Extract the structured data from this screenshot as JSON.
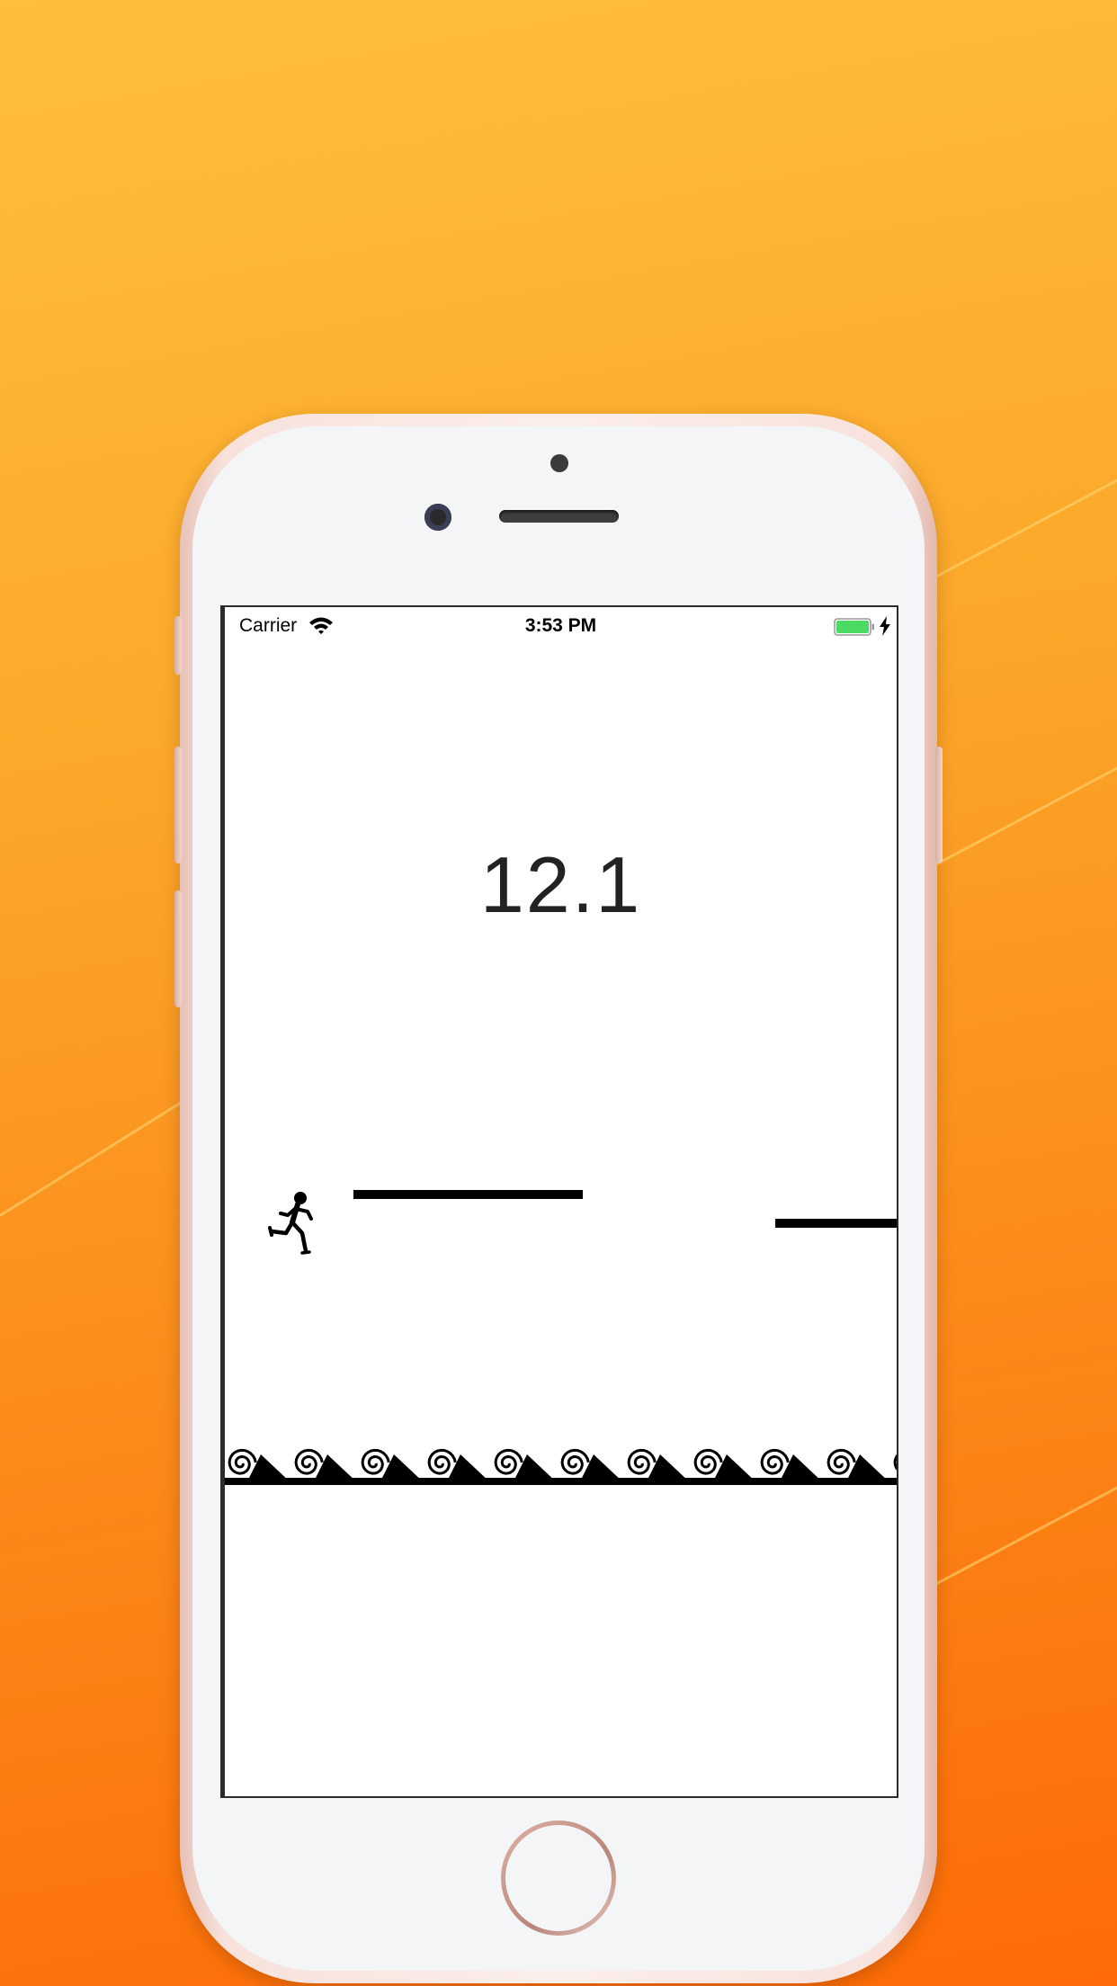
{
  "status_bar": {
    "carrier": "Carrier",
    "time": "3:53 PM",
    "battery_color": "#4cd964"
  },
  "game": {
    "score": "12.1"
  },
  "icons": [
    "wifi-icon",
    "battery-icon",
    "charging-bolt-icon",
    "runner-icon",
    "spiral-waves-icon",
    "camera-icon",
    "home-button-icon"
  ],
  "colors": {
    "background_top": "#fdbf3c",
    "background_bottom": "#fd6a06",
    "phone_body": "#f8e2dc",
    "screen": "#ffffff",
    "ink": "#000000"
  }
}
